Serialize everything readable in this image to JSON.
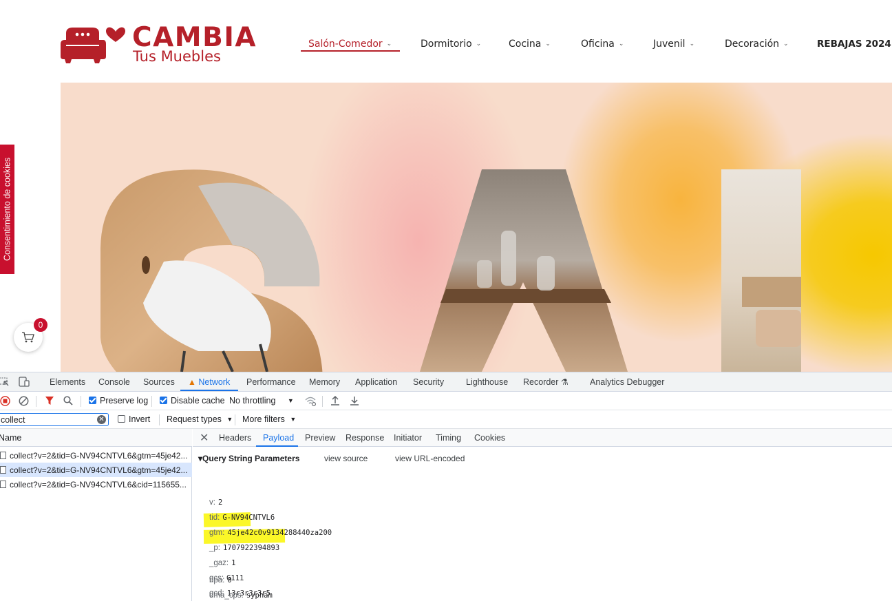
{
  "site": {
    "brand_line1": "CAMBIA",
    "brand_line2": "Tus Muebles",
    "accent": "#b52029",
    "nav": [
      {
        "label": "Salón-Comedor",
        "active": true
      },
      {
        "label": "Dormitorio"
      },
      {
        "label": "Cocina"
      },
      {
        "label": "Oficina"
      },
      {
        "label": "Juvenil"
      },
      {
        "label": "Decoración"
      },
      {
        "label": "REBAJAS 2024"
      }
    ],
    "cookie_tab": "Consentimiento de cookies",
    "cart_count": "0"
  },
  "devtools": {
    "tabs": [
      "Elements",
      "Console",
      "Sources",
      "Network",
      "Performance",
      "Memory",
      "Application",
      "Security",
      "Lighthouse",
      "Recorder",
      "Analytics Debugger"
    ],
    "active_tab": "Network",
    "toolbar": {
      "preserve_log": "Preserve log",
      "disable_cache": "Disable cache",
      "throttling": "No throttling"
    },
    "filter": {
      "value": "collect",
      "invert": "Invert",
      "request_types": "Request types",
      "more_filters": "More filters"
    },
    "name_header": "Name",
    "requests": [
      "collect?v=2&tid=G-NV94CNTVL6&gtm=45je42...",
      "collect?v=2&tid=G-NV94CNTVL6&gtm=45je42...",
      "collect?v=2&tid=G-NV94CNTVL6&cid=115655..."
    ],
    "detail_tabs": [
      "Headers",
      "Payload",
      "Preview",
      "Response",
      "Initiator",
      "Timing",
      "Cookies"
    ],
    "active_detail_tab": "Payload",
    "query_title": "▾Query String Parameters",
    "view_source": "view source",
    "view_url_encoded": "view URL-encoded",
    "params": [
      {
        "k": "v:",
        "v": "2"
      },
      {
        "k": "tid:",
        "v": "G-NV94CNTVL6"
      },
      {
        "k": "gtm:",
        "v": "45je42c0v9134288440za200"
      },
      {
        "k": "_p:",
        "v": "1707922394893"
      },
      {
        "k": "_gaz:",
        "v": "1"
      },
      {
        "k": "gcs:",
        "v": "G111",
        "highlight": true
      },
      {
        "k": "gcd:",
        "v": "13r3r3r3r5",
        "highlight": true
      },
      {
        "k": "npa:",
        "v": "0"
      },
      {
        "k": "dma_cps:",
        "v": "sypham"
      }
    ]
  }
}
